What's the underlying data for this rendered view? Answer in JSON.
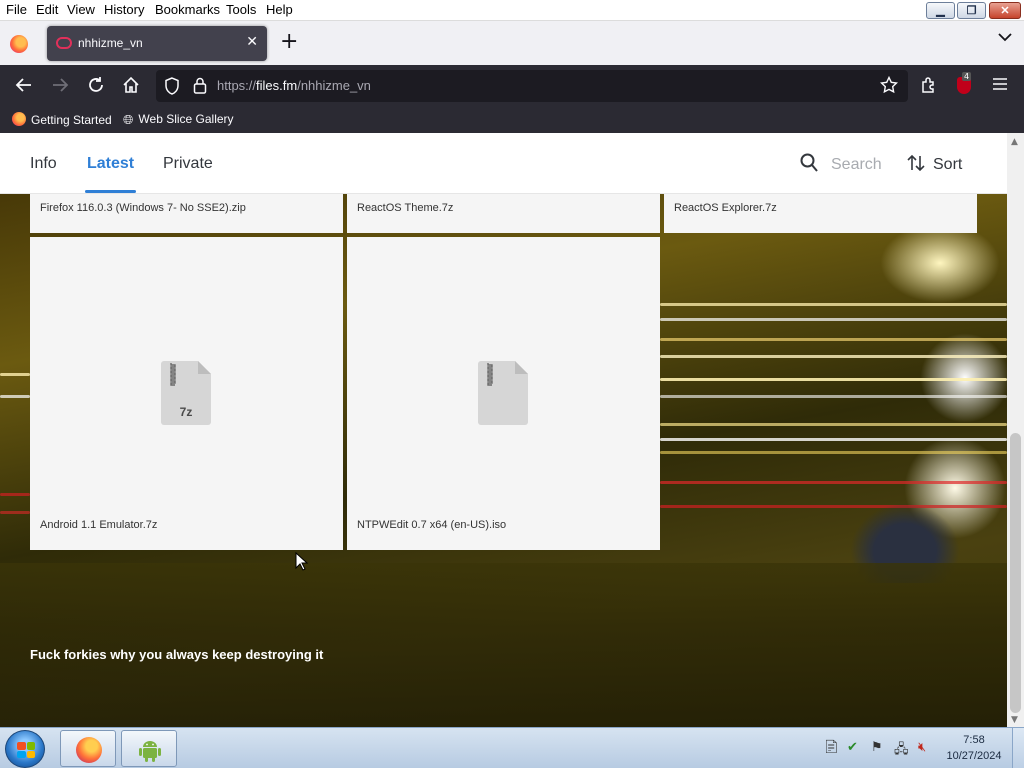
{
  "menubar": {
    "items": [
      {
        "label": "File"
      },
      {
        "label": "Edit"
      },
      {
        "label": "View"
      },
      {
        "label": "History"
      },
      {
        "label": "Bookmarks"
      },
      {
        "label": "Tools"
      },
      {
        "label": "Help"
      }
    ]
  },
  "tabs": {
    "active_title": "nhhizme_vn",
    "close_glyph": "✕",
    "new_tab_glyph": "+",
    "list_glyph": "⌄"
  },
  "navbar": {
    "url_prefix": "https://",
    "url_host": "files.fm",
    "url_path": "/nhhizme_vn",
    "ublock_badge": "4"
  },
  "bookmarks": {
    "items": [
      {
        "label": "Getting Started",
        "icon": "firefox-icon"
      },
      {
        "label": "Web Slice Gallery",
        "icon": "globe-icon"
      }
    ]
  },
  "site": {
    "nav": [
      {
        "label": "Info"
      },
      {
        "label": "Latest"
      },
      {
        "label": "Private"
      }
    ],
    "search_placeholder": "Search",
    "sort_label": "Sort",
    "files": [
      {
        "name": "Firefox 116.0.3 (Windows 7- No SSE2).zip"
      },
      {
        "name": "ReactOS Theme.7z"
      },
      {
        "name": "ReactOS Explorer.7z"
      },
      {
        "name": "Android 1.1 Emulator.7z",
        "type_label": "7z"
      },
      {
        "name": "NTPWEdit 0.7 x64 (en-US).iso",
        "type_label": ""
      }
    ],
    "message": "Fuck forkies why you always keep destroying it"
  },
  "taskbar": {
    "time": "7:58",
    "date": "10/27/2024"
  },
  "colors": {
    "accent": "#2f7fd6",
    "toolbar_dark": "#2b2a33",
    "urlbar_bg": "#1c1b22"
  }
}
